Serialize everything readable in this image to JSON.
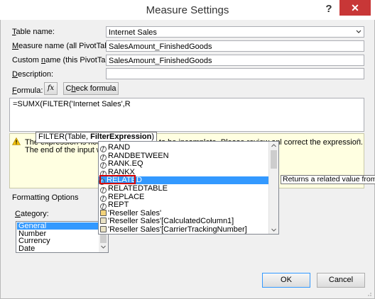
{
  "window": {
    "title": "Measure Settings",
    "help": "?",
    "close": "✕"
  },
  "fields": {
    "table_name": {
      "label_pre": "",
      "label_ul": "T",
      "label_post": "able name:",
      "value": "Internet Sales"
    },
    "measure_name": {
      "label_pre": "",
      "label_ul": "M",
      "label_post": "easure name (all PivotTables):",
      "value": "SalesAmount_FinishedGoods"
    },
    "custom_name": {
      "label_pre": "Custom ",
      "label_ul": "n",
      "label_post": "ame (this PivotTable):",
      "value": "SalesAmount_FinishedGoods"
    },
    "description": {
      "label_pre": "",
      "label_ul": "D",
      "label_post": "escription:",
      "value": ""
    }
  },
  "formula": {
    "label_pre": "",
    "label_ul": "F",
    "label_post": "ormula:",
    "fx_button": "fx",
    "check_button_pre": "C",
    "check_button_ul": "h",
    "check_button_post": "eck formula",
    "text": "=SUMX(FILTER('Internet Sales',R"
  },
  "error": {
    "line1": "The expression is not valid or appears to be incomplete. Please review and correct the expression.",
    "line2": "The end of the input was reached."
  },
  "tooltip": {
    "prefix": "FILTER(Table, ",
    "bold": "FilterExpression",
    "suffix": ")"
  },
  "autocomplete": {
    "items": [
      {
        "label": "RAND",
        "icon": "function-icon"
      },
      {
        "label": "RANDBETWEEN",
        "icon": "function-icon"
      },
      {
        "label": "RANK.EQ",
        "icon": "function-icon"
      },
      {
        "label": "RANKX",
        "icon": "function-icon"
      },
      {
        "label": "RELATED",
        "icon": "function-icon",
        "selected": true
      },
      {
        "label": "RELATEDTABLE",
        "icon": "function-icon"
      },
      {
        "label": "REPLACE",
        "icon": "function-icon"
      },
      {
        "label": "REPT",
        "icon": "function-icon"
      },
      {
        "label": "'Reseller Sales'",
        "icon": "table-icon"
      },
      {
        "label": "'Reseller Sales'[CalculatedColumn1]",
        "icon": "column-icon"
      },
      {
        "label": "'Reseller Sales'[CarrierTrackingNumber]",
        "icon": "column-icon"
      }
    ],
    "hint": "Returns a related value from anoth"
  },
  "formatting": {
    "heading": "Formatting Options",
    "category_label_pre": "",
    "category_label_ul": "C",
    "category_label_post": "ategory:",
    "categories": [
      "General",
      "Number",
      "Currency",
      "Date"
    ],
    "selected_category": "General"
  },
  "buttons": {
    "ok": "OK",
    "cancel": "Cancel"
  },
  "colors": {
    "selection": "#3399ff",
    "highlight_border": "#d40000",
    "close_bg": "#c83737"
  }
}
